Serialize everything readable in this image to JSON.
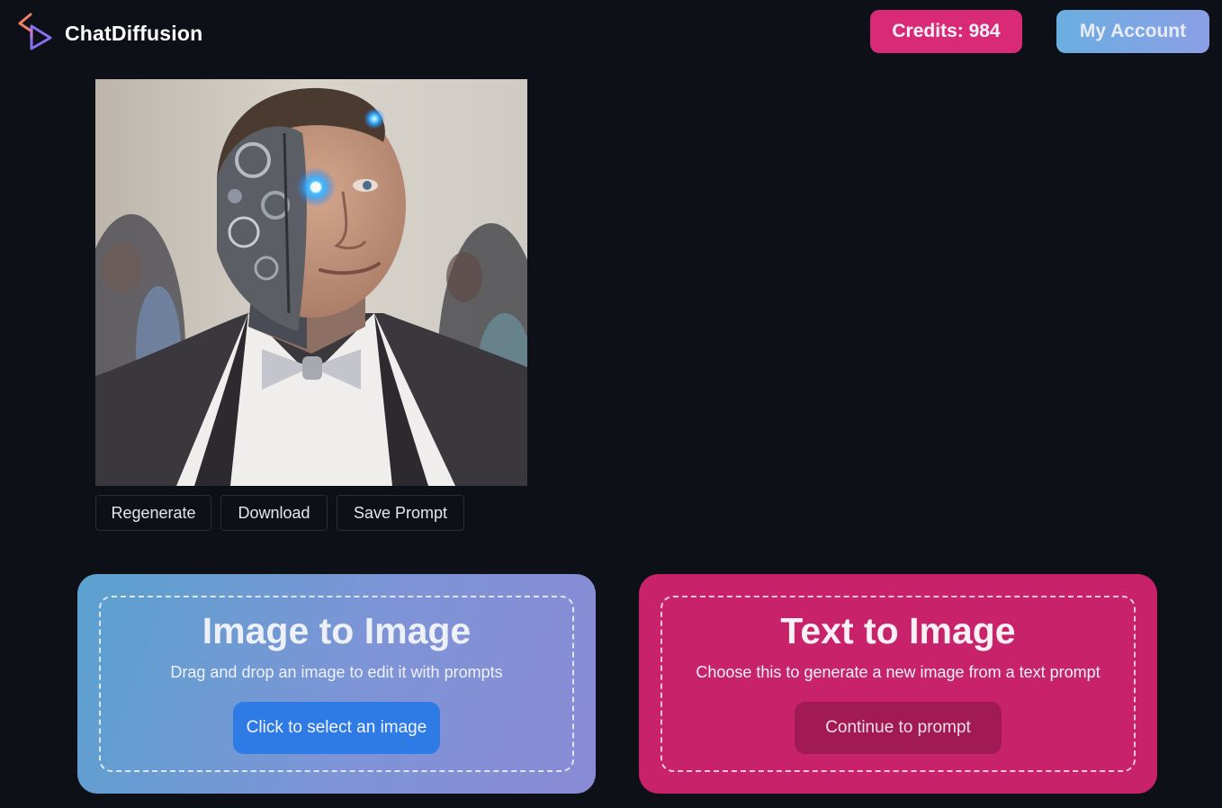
{
  "header": {
    "app_name": "ChatDiffusion",
    "logo_icon": "chatdiffusion-logo-icon",
    "credits_label": "Credits: 984",
    "account_label": "My Account"
  },
  "generated_image": {
    "description_icon": "generated-image"
  },
  "actions": {
    "regenerate": "Regenerate",
    "download": "Download",
    "save_prompt": "Save Prompt"
  },
  "cards": {
    "image_to_image": {
      "title": "Image to Image",
      "subtitle": "Drag and drop an image to edit it with prompts",
      "button": "Click to select an image"
    },
    "text_to_image": {
      "title": "Text to Image",
      "subtitle": "Choose this to generate a new image from a text prompt",
      "button": "Continue to prompt"
    }
  },
  "colors": {
    "background": "#0e1017",
    "credits": "#d92a78",
    "accent_blue": "#2f7be6",
    "card_pink": "#c8236a"
  }
}
